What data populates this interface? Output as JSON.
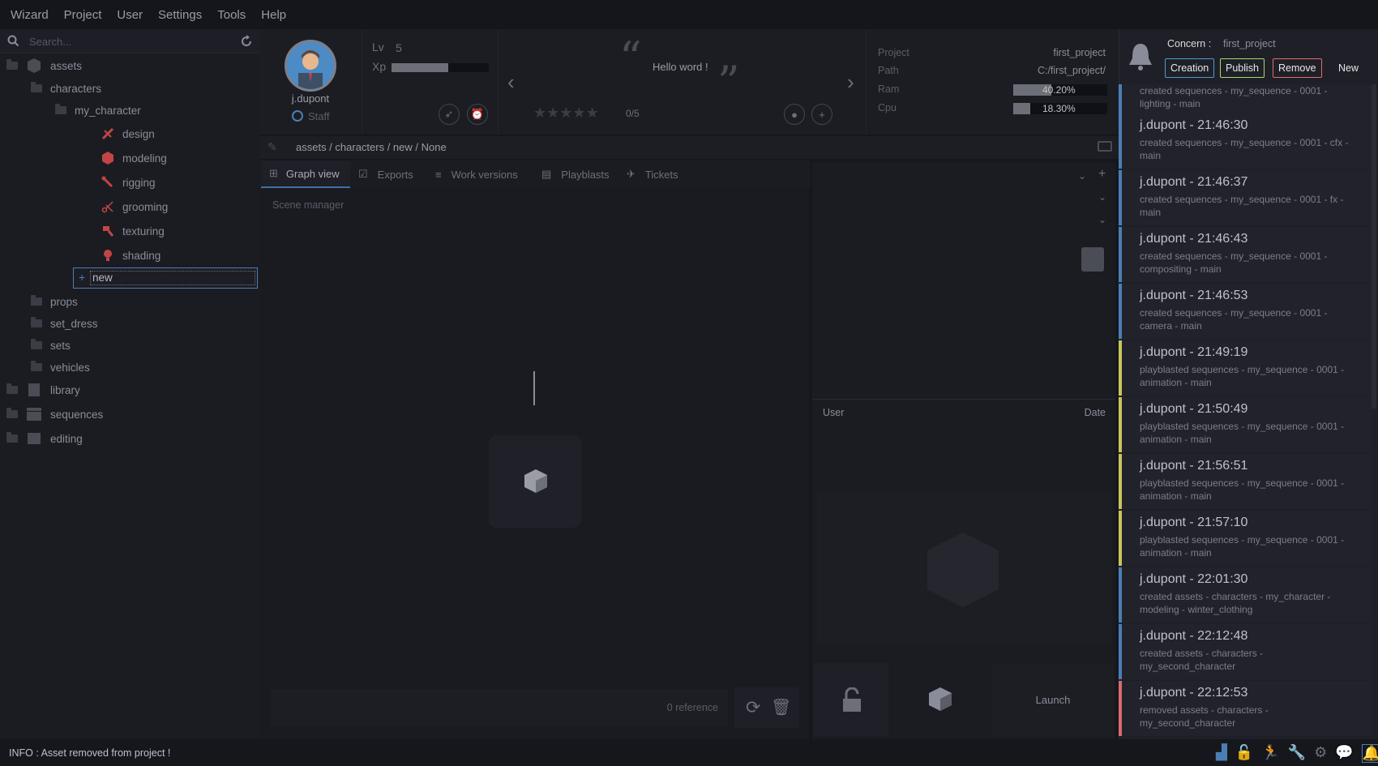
{
  "menu": [
    "Wizard",
    "Project",
    "User",
    "Settings",
    "Tools",
    "Help"
  ],
  "search": {
    "placeholder": "Search..."
  },
  "tree": {
    "assets": "assets",
    "characters": "characters",
    "my_character": "my_character",
    "stages": [
      "design",
      "modeling",
      "rigging",
      "grooming",
      "texturing",
      "shading"
    ],
    "new_input": "new",
    "props": "props",
    "set_dress": "set_dress",
    "sets": "sets",
    "vehicles": "vehicles",
    "library": "library",
    "sequences": "sequences",
    "editing": "editing"
  },
  "user": {
    "name": "j.dupont",
    "role": "Staff",
    "lv_label": "Lv",
    "lv": "5",
    "xp_label": "Xp",
    "xp_progress": 0.58
  },
  "quote": {
    "text": "Hello word !",
    "rating": "0/5"
  },
  "project": {
    "project_label": "Project",
    "project_value": "first_project",
    "path_label": "Path",
    "path_value": "C:/first_project/",
    "ram_label": "Ram",
    "ram_value": "40.20%",
    "ram": 0.402,
    "cpu_label": "Cpu",
    "cpu_value": "18.30%",
    "cpu": 0.183
  },
  "breadcrumb": "assets / characters / new / None",
  "tabs": [
    "Graph view",
    "Exports",
    "Work versions",
    "Playblasts",
    "Tickets"
  ],
  "scene_manager": "Scene manager",
  "references": "0 reference",
  "right_panel": {
    "user_col": "User",
    "date_col": "Date",
    "launch": "Launch"
  },
  "notifications": {
    "concern_label": "Concern :",
    "concern_value": "first_project",
    "filters": [
      {
        "label": "Creation",
        "color": "#4a9ad6"
      },
      {
        "label": "Publish",
        "color": "#a6d96a"
      },
      {
        "label": "Remove",
        "color": "#e26a6a"
      },
      {
        "label": "New",
        "color": "#1f2027"
      }
    ],
    "partial": "created  sequences - my_sequence - 0001 - lighting - main",
    "items": [
      {
        "title": "j.dupont - 21:46:30",
        "desc": "created  sequences - my_sequence - 0001 - cfx - main",
        "kind": "created"
      },
      {
        "title": "j.dupont - 21:46:37",
        "desc": "created  sequences - my_sequence - 0001 - fx - main",
        "kind": "created"
      },
      {
        "title": "j.dupont - 21:46:43",
        "desc": "created  sequences - my_sequence - 0001 - compositing - main",
        "kind": "created"
      },
      {
        "title": "j.dupont - 21:46:53",
        "desc": "created  sequences - my_sequence - 0001 - camera - main",
        "kind": "created"
      },
      {
        "title": "j.dupont - 21:49:19",
        "desc": "playblasted  sequences - my_sequence - 0001 - animation - main",
        "kind": "playblasted"
      },
      {
        "title": "j.dupont - 21:50:49",
        "desc": "playblasted  sequences - my_sequence - 0001 - animation - main",
        "kind": "playblasted"
      },
      {
        "title": "j.dupont - 21:56:51",
        "desc": "playblasted  sequences - my_sequence - 0001 - animation - main",
        "kind": "playblasted"
      },
      {
        "title": "j.dupont - 21:57:10",
        "desc": "playblasted  sequences - my_sequence - 0001 - animation - main",
        "kind": "playblasted"
      },
      {
        "title": "j.dupont - 22:01:30",
        "desc": "created  assets - characters - my_character - modeling - winter_clothing",
        "kind": "created"
      },
      {
        "title": "j.dupont - 22:12:48",
        "desc": "created  assets - characters - my_second_character",
        "kind": "created"
      },
      {
        "title": "j.dupont - 22:12:53",
        "desc": "removed  assets - characters - my_second_character",
        "kind": "removed"
      }
    ]
  },
  "status": "INFO : Asset removed from project !"
}
